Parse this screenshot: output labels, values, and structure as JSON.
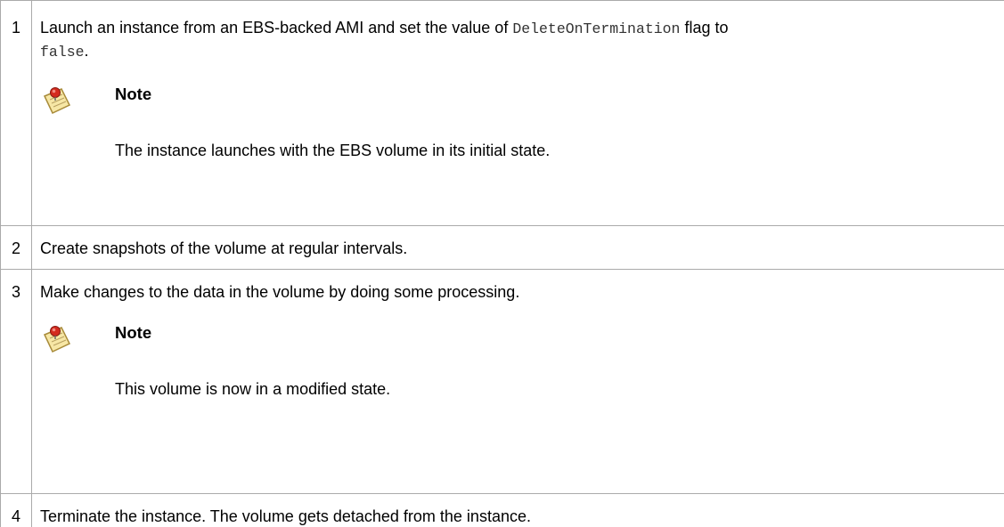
{
  "steps": [
    {
      "number": "1",
      "text_before": "Launch an instance from an EBS-backed AMI and set the value of ",
      "code_1": "DeleteOnTermination",
      "text_middle": " flag to ",
      "code_2": "false",
      "text_after": ".",
      "note": {
        "title": "Note",
        "body": "The instance launches with the EBS volume in its initial state."
      }
    },
    {
      "number": "2",
      "text": "Create snapshots of the volume at regular intervals."
    },
    {
      "number": "3",
      "text": "Make changes to the data in the volume by doing some processing.",
      "note": {
        "title": "Note",
        "body": "This volume is now in a modified state."
      }
    },
    {
      "number": "4",
      "text": "Terminate the instance. The volume gets detached from the instance."
    }
  ],
  "icons": {
    "note": "note-pushpin-icon"
  },
  "colors": {
    "border": "#aaaaaa",
    "text": "#000000",
    "code": "#333333"
  }
}
